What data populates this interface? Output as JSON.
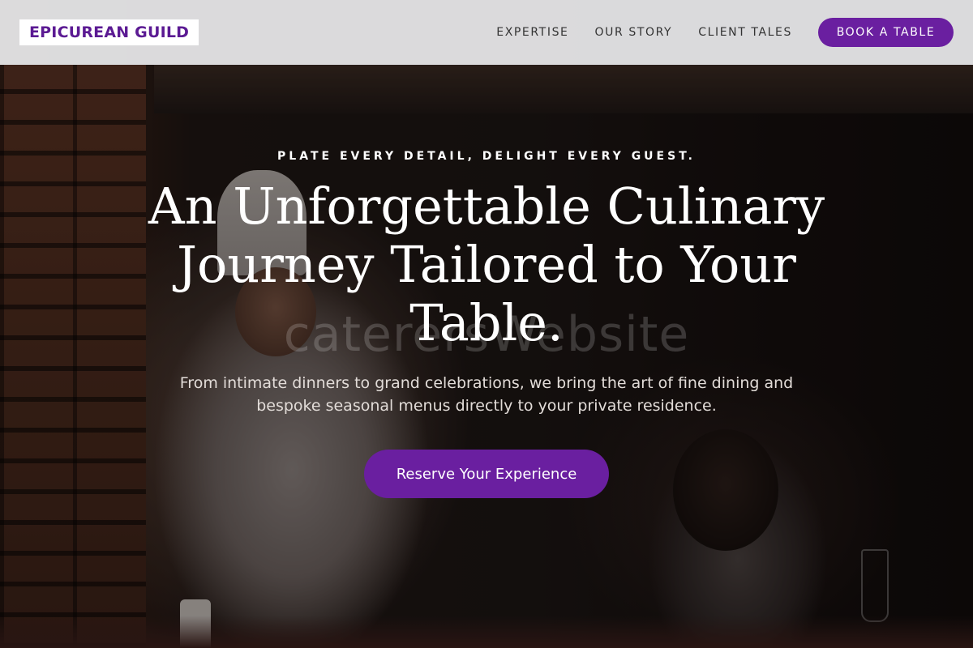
{
  "brand": {
    "name": "EPICUREAN GUILD",
    "accent_color": "#6a1fa0"
  },
  "nav": {
    "links": [
      "EXPERTISE",
      "OUR STORY",
      "CLIENT TALES"
    ],
    "cta_label": "BOOK A TABLE"
  },
  "hero": {
    "eyebrow": "PLATE EVERY DETAIL, DELIGHT EVERY GUEST.",
    "headline": "An Unforgettable Culinary Journey Tailored to Your Table.",
    "subtext": "From intimate dinners to grand celebrations, we bring the art of fine dining and bespoke seasonal menus directly to your private residence.",
    "cta_label": "Reserve Your Experience",
    "watermark": "caterersWebsite"
  }
}
